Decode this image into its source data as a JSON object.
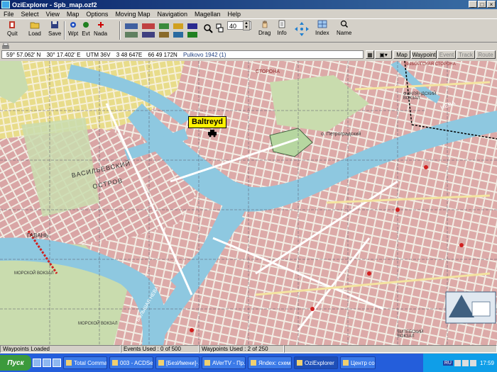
{
  "window": {
    "title": "OziExplorer - Spb_map.ozf2",
    "controls": [
      "_",
      "□",
      "×"
    ]
  },
  "menu": [
    "File",
    "Select",
    "View",
    "Map",
    "Options",
    "Moving Map",
    "Navigation",
    "Magellan",
    "Help"
  ],
  "toolbar": {
    "quit": "Quit",
    "load": "Load",
    "save": "Save",
    "wpt": "Wpt",
    "evt": "Evt",
    "nada": "Nada",
    "zoom_value": "40",
    "drag": "Drag",
    "info": "Info",
    "index": "Index",
    "name": "Name"
  },
  "coords": {
    "lat": "59° 57.062' N",
    "lon": "30° 17.402' E",
    "utm": "UTM  36V",
    "easting": "3 48 647E",
    "northing": "66 49 172N",
    "datum": "Pulkovo 1942 (1)"
  },
  "view_tabs": [
    {
      "label": "Map",
      "enabled": true
    },
    {
      "label": "Waypoint",
      "enabled": true
    },
    {
      "label": "Event",
      "enabled": false
    },
    {
      "label": "Track",
      "enabled": false
    },
    {
      "label": "Route",
      "enabled": false
    }
  ],
  "map": {
    "waypoint_label": "Baltreyd",
    "labels": {
      "vasilievsky": "ВАСИЛЬЕВСКИЙ",
      "ostrov": "ОСТРОВ",
      "gavan": "ГАВАНЬ",
      "petrogradsky": "о. Петроградский",
      "finlyandsky": "ФИНЛЯНДСКИЙ ВОКЗАЛ",
      "vyborgskaya": "ВЫБОРГСКАЯ СТОРОНА",
      "neva": "НЕВА",
      "bolshaya_neva": "БОЛЬШАЯ НЕВА",
      "morskoy1": "МОРСКОЙ ВОКЗАЛ",
      "morskoy2": "МОРСКОЙ ВОКЗАЛ",
      "storona": "СТОРОНА",
      "vitebsky": "ВИТЕБСКИЙ ВОКЗАЛ"
    }
  },
  "status": {
    "left": "Waypoints Loaded",
    "events": "Events Used : 0 of 500",
    "waypoints": "Waypoints Used : 2 of 250"
  },
  "taskbar": {
    "start": "Пуск",
    "tasks": [
      "Total Comma...",
      "003 - ACDSe...",
      "[БезИмени]-...",
      "AVerTV - Пр...",
      "Яndex: схем...",
      "OziExplorer",
      "Центр созда..."
    ],
    "active_task": "OziExplorer",
    "lang": "RU",
    "clock": "17:59"
  },
  "colors": {
    "title_bar": "#0a246a",
    "water": "#8ec8e0",
    "blocks": "#d8a8a8",
    "parks": "#c9dcae",
    "taskbar": "#245edb"
  }
}
